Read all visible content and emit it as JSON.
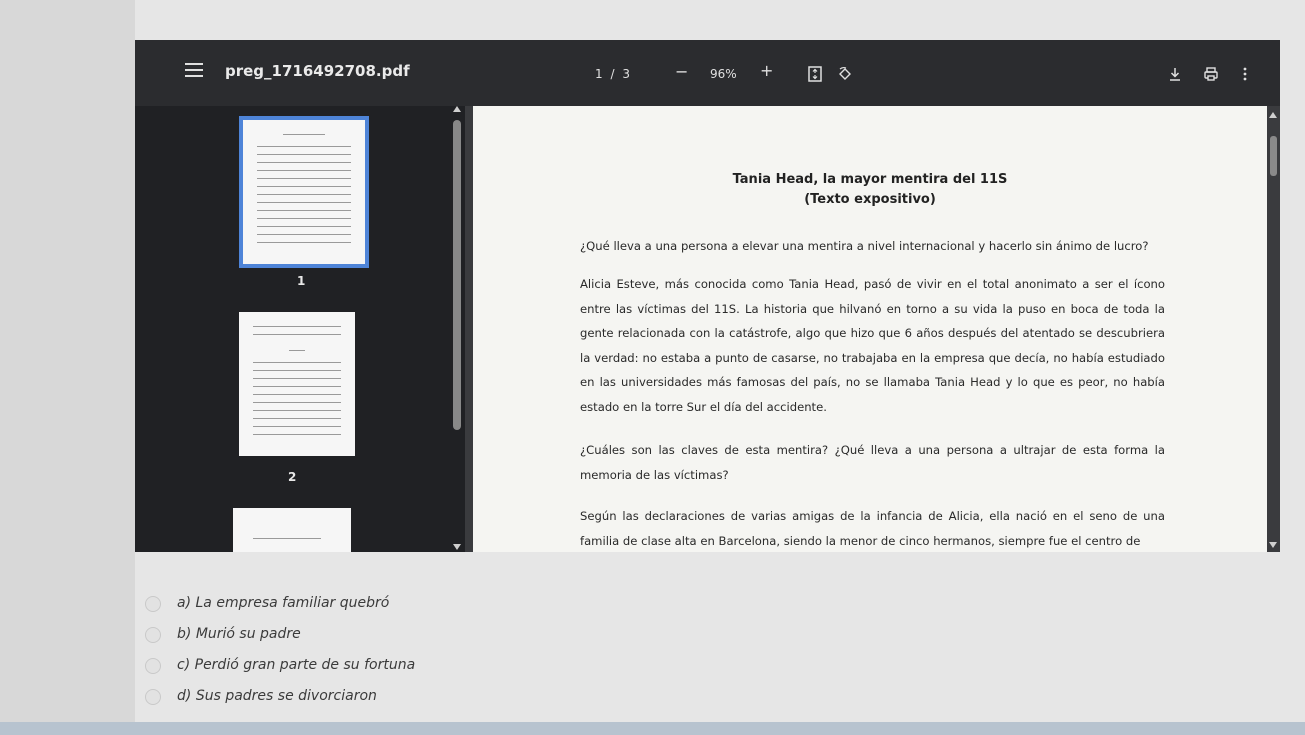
{
  "viewer": {
    "filename": "preg_1716492708.pdf",
    "page_current": "1",
    "page_separator": "/",
    "page_total": "3",
    "zoom_out": "−",
    "zoom": "96%",
    "zoom_in": "+",
    "icons": [
      "menu-icon",
      "fit-page-icon",
      "rotate-icon",
      "download-icon",
      "print-icon",
      "more-options-icon"
    ]
  },
  "thumbnails": [
    {
      "number": "1",
      "selected": true
    },
    {
      "number": "2",
      "selected": false
    }
  ],
  "document": {
    "title": "Tania Head, la mayor mentira del 11S",
    "subtitle": "(Texto expositivo)",
    "question1": "¿Qué lleva a una persona a elevar una mentira a nivel internacional y hacerlo sin ánimo de lucro?",
    "para1": "Alicia Esteve, más conocida como Tania Head, pasó de vivir en el total anonimato a ser el ícono entre las víctimas del 11S. La historia que hilvanó en torno a su vida la puso en boca de toda la gente relacionada con la catástrofe, algo que hizo que 6 años después del atentado se descubriera la verdad: no estaba a punto de casarse, no trabajaba en la empresa que decía, no había estudiado en las universidades más famosas del país, no se llamaba Tania Head y lo que es peor, no había estado en la torre Sur el día del accidente.",
    "para2": "¿Cuáles son las claves de esta mentira? ¿Qué lleva a una persona a ultrajar de esta forma la memoria de las víctimas?",
    "para3": "Según las declaraciones de varias amigas de la infancia de Alicia, ella nació en el seno de una familia de clase alta en Barcelona, siendo la menor de cinco hermanos, siempre fue el centro de"
  },
  "options": [
    {
      "letter": "a)",
      "text": "La empresa familiar quebró"
    },
    {
      "letter": "b)",
      "text": "Murió su padre"
    },
    {
      "letter": "c)",
      "text": "Perdió gran parte de su fortuna"
    },
    {
      "letter": "d)",
      "text": "Sus padres se divorciaron"
    }
  ]
}
